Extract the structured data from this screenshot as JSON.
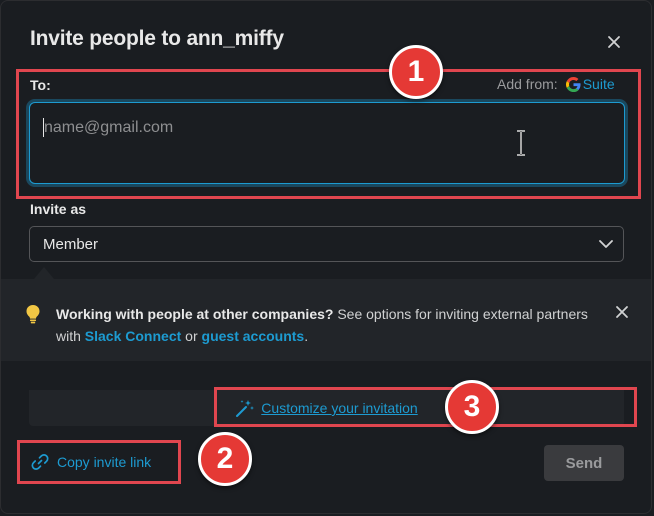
{
  "modal": {
    "title": "Invite people to ann_miffy",
    "close_icon": "close-icon"
  },
  "to_field": {
    "label": "To:",
    "add_from_label": "Add from:",
    "provider_icon": "google-g-icon",
    "provider_label": "Suite",
    "placeholder": "name@gmail.com",
    "value": ""
  },
  "invite_as": {
    "label": "Invite as",
    "selected": "Member",
    "chevron_icon": "chevron-down-icon"
  },
  "tip": {
    "icon": "lightbulb-icon",
    "bold_text": "Working with people at other companies?",
    "text_1": " See options for inviting external partners with ",
    "link_1": "Slack Connect",
    "text_2": " or ",
    "link_2": "guest accounts",
    "text_3": "."
  },
  "customize": {
    "icon": "magic-wand-icon",
    "label": "Customize your invitation"
  },
  "footer": {
    "copy_link_icon": "link-icon",
    "copy_link_label": "Copy invite link",
    "send_label": "Send"
  },
  "annotations": {
    "badge_1": "1",
    "badge_2": "2",
    "badge_3": "3",
    "highlight_color": "#e0464f"
  },
  "colors": {
    "background": "#1a1d21",
    "accent": "#1d9bd1",
    "tip_background": "#222529",
    "button_disabled": "#3a3b3e"
  }
}
